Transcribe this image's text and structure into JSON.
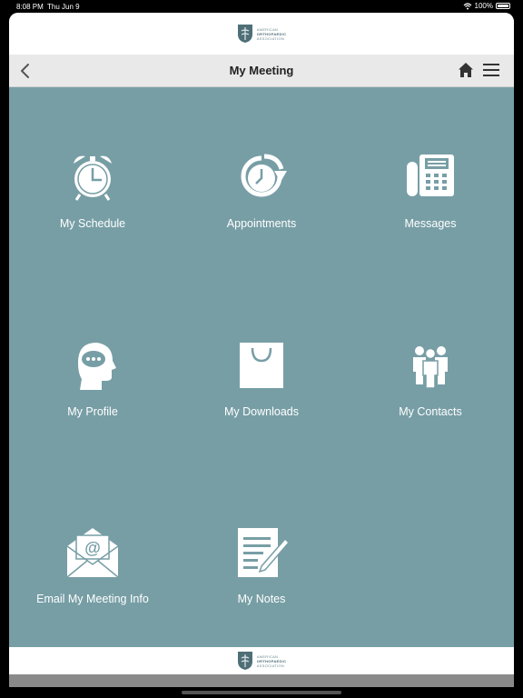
{
  "status": {
    "time": "8:08 PM",
    "date": "Thu Jun 9",
    "battery": "100%"
  },
  "brand": {
    "line1": "AMERICAN",
    "line2": "ORTHOPAEDIC",
    "line3": "ASSOCIATION"
  },
  "nav": {
    "title": "My Meeting"
  },
  "tiles": [
    {
      "label": "My Schedule",
      "icon": "alarm-clock-icon"
    },
    {
      "label": "Appointments",
      "icon": "clock-arrow-icon"
    },
    {
      "label": "Messages",
      "icon": "fax-phone-icon"
    },
    {
      "label": "My Profile",
      "icon": "head-speech-icon"
    },
    {
      "label": "My Downloads",
      "icon": "shopping-bag-icon"
    },
    {
      "label": "My Contacts",
      "icon": "people-group-icon"
    },
    {
      "label": "Email My Meeting Info",
      "icon": "email-envelope-icon"
    },
    {
      "label": "My Notes",
      "icon": "notes-pencil-icon"
    }
  ],
  "colors": {
    "grid_bg": "#779ea5",
    "navbar_bg": "#e9e9e9"
  }
}
